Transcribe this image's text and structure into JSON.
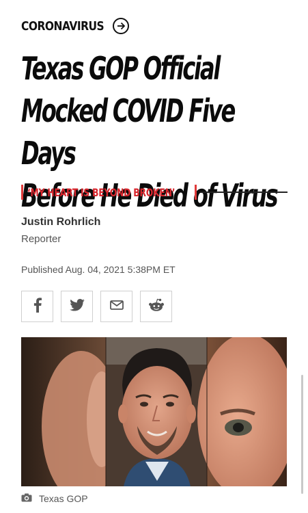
{
  "section": {
    "label": "CORONAVIRUS"
  },
  "headline": {
    "line1": "Texas GOP Official",
    "line2": "Mocked COVID Five Days",
    "line3": "Before He Died of Virus"
  },
  "subhead": "‘MY HEART IS BEYOND BROKEN’",
  "author": {
    "name": "Justin Rohrlich",
    "role": "Reporter"
  },
  "published": "Published Aug. 04, 2021 5:38PM ET",
  "share": [
    {
      "icon": "facebook-icon"
    },
    {
      "icon": "twitter-icon"
    },
    {
      "icon": "email-icon"
    },
    {
      "icon": "reddit-icon"
    }
  ],
  "photo": {
    "icon": "camera-icon",
    "credit": "Texas GOP"
  },
  "colors": {
    "accent": "#d8262d",
    "text": "#111111",
    "muted": "#555555"
  }
}
